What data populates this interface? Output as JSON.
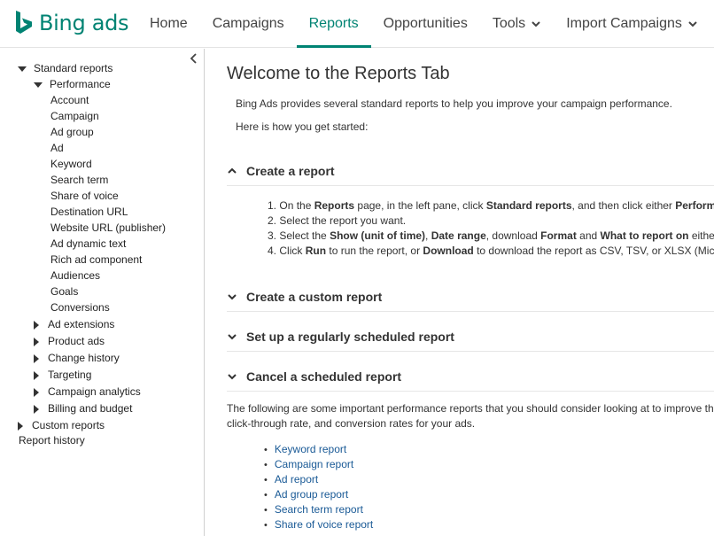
{
  "brand": {
    "name": "Bing ads",
    "color": "#008373"
  },
  "nav": {
    "items": [
      {
        "label": "Home"
      },
      {
        "label": "Campaigns"
      },
      {
        "label": "Reports",
        "active": true
      },
      {
        "label": "Opportunities"
      },
      {
        "label": "Tools",
        "dropdown": true
      },
      {
        "label": "Import Campaigns",
        "dropdown": true
      }
    ]
  },
  "sidebar": {
    "standard_reports": "Standard reports",
    "performance": "Performance",
    "performance_items": [
      "Account",
      "Campaign",
      "Ad group",
      "Ad",
      "Keyword",
      "Search term",
      "Share of voice",
      "Destination URL",
      "Website URL (publisher)",
      "Ad dynamic text",
      "Rich ad component",
      "Audiences",
      "Goals",
      "Conversions"
    ],
    "collapsed_groups": [
      "Ad extensions",
      "Product ads",
      "Change history",
      "Targeting",
      "Campaign analytics",
      "Billing and budget"
    ],
    "custom_reports": "Custom reports",
    "report_history": "Report history",
    "collapse_icon": "chevron-left-icon"
  },
  "main": {
    "title": "Welcome to the Reports Tab",
    "intro1": "Bing Ads provides several standard reports to help you improve your campaign performance.",
    "intro2": "Here is how you get started:",
    "sections": [
      {
        "label": "Create a report",
        "expanded": true
      },
      {
        "label": "Create a custom report",
        "expanded": false
      },
      {
        "label": "Set up a regularly scheduled report",
        "expanded": false
      },
      {
        "label": "Cancel a scheduled report",
        "expanded": false
      }
    ],
    "steps": [
      {
        "num": "1.",
        "parts": [
          [
            "t",
            "On the "
          ],
          [
            "b",
            "Reports"
          ],
          [
            "t",
            " page, in the left pane, click "
          ],
          [
            "b",
            "Standard reports"
          ],
          [
            "t",
            ", and then click either "
          ],
          [
            "b",
            "Performance"
          ]
        ]
      },
      {
        "num": "2.",
        "parts": [
          [
            "t",
            "Select the report you want."
          ]
        ]
      },
      {
        "num": "3.",
        "parts": [
          [
            "t",
            "Select the "
          ],
          [
            "b",
            "Show (unit of time)"
          ],
          [
            "t",
            ", "
          ],
          [
            "b",
            "Date range"
          ],
          [
            "t",
            ", download "
          ],
          [
            "b",
            "Format"
          ],
          [
            "t",
            " and "
          ],
          [
            "b",
            "What to report on"
          ],
          [
            "t",
            " either"
          ]
        ]
      },
      {
        "num": "4.",
        "parts": [
          [
            "t",
            "Click "
          ],
          [
            "b",
            "Run"
          ],
          [
            "t",
            " to run the report, or "
          ],
          [
            "b",
            "Download"
          ],
          [
            "t",
            " to download the report as CSV, TSV, or XLSX (Microsoft"
          ]
        ]
      }
    ],
    "paragraph": "The following are some important performance reports that you should consider looking at to improve the click-through rate, and conversion rates for your ads.",
    "links": [
      "Keyword report",
      "Campaign report",
      "Ad report",
      "Ad group report",
      "Search term report",
      "Share of voice report"
    ]
  }
}
